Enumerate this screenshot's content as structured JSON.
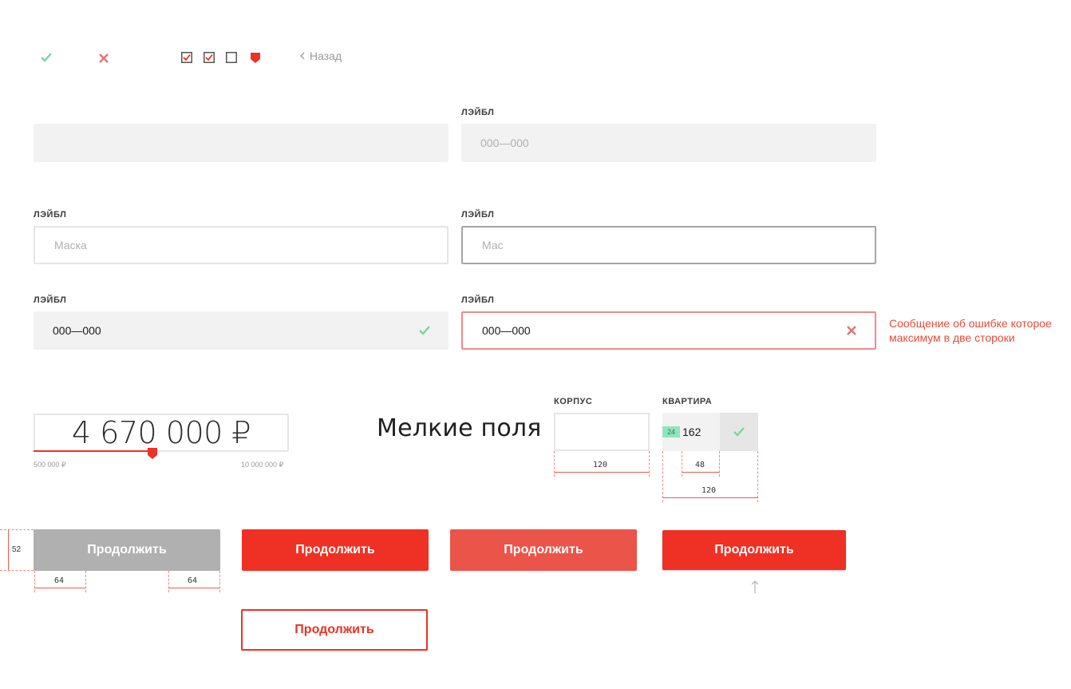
{
  "icons": {
    "check_color": "#7dd3a0",
    "cross_color": "#e57373",
    "accent": "#ee3124"
  },
  "back_link": {
    "label": "Назад"
  },
  "form": {
    "row1": {
      "left": {
        "value": ""
      },
      "right": {
        "label": "ЛЭЙБЛ",
        "placeholder": "000—000"
      }
    },
    "row2": {
      "left": {
        "label": "ЛЭЙБЛ",
        "placeholder": "Маска"
      },
      "right": {
        "label": "ЛЭЙБЛ",
        "placeholder": "Мас"
      }
    },
    "row3": {
      "left": {
        "label": "ЛЭЙБЛ",
        "value": "000—000"
      },
      "right": {
        "label": "ЛЭЙБЛ",
        "value": "000—000"
      }
    },
    "error_message": "Сообщение об ошибке которое максимум в две стороки"
  },
  "price": {
    "value": "4 670 000 ₽",
    "min": "500 000 ₽",
    "max": "10 000 000 ₽",
    "fraction": 0.47
  },
  "small_fields": {
    "title": "Мелкие поля",
    "korpus": {
      "label": "КОРПУС",
      "value": ""
    },
    "kvartira": {
      "label": "КВАРТИРА",
      "badge": "24",
      "value": "162"
    },
    "dims": {
      "korpus_width": "120",
      "kvartira_inner": "48",
      "kvartira_width": "120"
    }
  },
  "buttons": {
    "disabled": "Продолжить",
    "primary": "Продолжить",
    "hover": "Продолжить",
    "pressed": "Продолжить",
    "outline": "Продолжить",
    "dims": {
      "height": "52",
      "pad_left": "64",
      "pad_right": "64"
    }
  }
}
